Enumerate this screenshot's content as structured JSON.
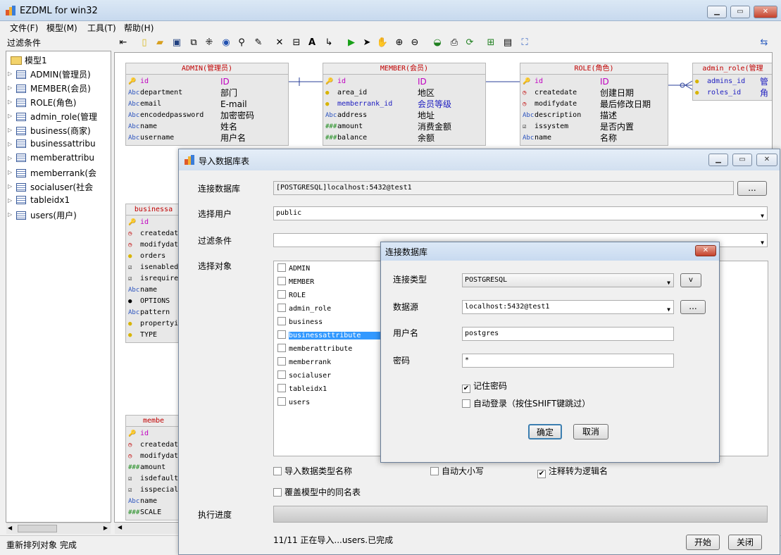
{
  "window": {
    "title": "EZDML for win32"
  },
  "menu": [
    "文件(F)",
    "模型(M)",
    "工具(T)",
    "帮助(H)"
  ],
  "left_panel": {
    "filter_label": "过滤条件",
    "root": "模型1",
    "items": [
      "ADMIN(管理员)",
      "MEMBER(会员)",
      "ROLE(角色)",
      "admin_role(管理",
      "business(商家)",
      "businessattribu",
      "memberattribu",
      "memberrank(会",
      "socialuser(社会",
      "tableidx1",
      "users(用户)"
    ]
  },
  "entities": {
    "admin": {
      "title": "ADMIN(管理员)",
      "fields": [
        {
          "icon": "key",
          "name": "id",
          "label": "ID",
          "kind": "pk"
        },
        {
          "icon": "abc",
          "name": "department",
          "label": "部门"
        },
        {
          "icon": "abc",
          "name": "email",
          "label": "E-mail"
        },
        {
          "icon": "abc",
          "name": "encodedpassword",
          "label": "加密密码"
        },
        {
          "icon": "abc",
          "name": "name",
          "label": "姓名"
        },
        {
          "icon": "abc",
          "name": "username",
          "label": "用户名"
        }
      ]
    },
    "member": {
      "title": "MEMBER(会员)",
      "fields": [
        {
          "icon": "key",
          "name": "id",
          "label": "ID",
          "kind": "pk"
        },
        {
          "icon": "bulb",
          "name": "area_id",
          "label": "地区"
        },
        {
          "icon": "bulb",
          "name": "memberrank_id",
          "label": "会员等级",
          "kind": "fk"
        },
        {
          "icon": "abc",
          "name": "address",
          "label": "地址"
        },
        {
          "icon": "num",
          "name": "amount",
          "label": "消费金额"
        },
        {
          "icon": "num",
          "name": "balance",
          "label": "余额"
        }
      ]
    },
    "role": {
      "title": "ROLE(角色)",
      "fields": [
        {
          "icon": "key",
          "name": "id",
          "label": "ID",
          "kind": "pk"
        },
        {
          "icon": "clock",
          "name": "createdate",
          "label": "创建日期"
        },
        {
          "icon": "clock",
          "name": "modifydate",
          "label": "最后修改日期"
        },
        {
          "icon": "abc",
          "name": "description",
          "label": "描述"
        },
        {
          "icon": "check",
          "name": "issystem",
          "label": "是否内置"
        },
        {
          "icon": "abc",
          "name": "name",
          "label": "名称"
        }
      ]
    },
    "admin_role": {
      "title": "admin_role(管理",
      "fields": [
        {
          "icon": "bulb",
          "name": "admins_id",
          "label": "管",
          "kind": "fk"
        },
        {
          "icon": "bulb",
          "name": "roles_id",
          "label": "角",
          "kind": "fk"
        }
      ]
    },
    "business": {
      "title": "businessa",
      "fields": [
        {
          "icon": "key",
          "name": "id",
          "kind": "pk"
        },
        {
          "icon": "clock",
          "name": "createdat"
        },
        {
          "icon": "clock",
          "name": "modifydat"
        },
        {
          "icon": "bulb",
          "name": "orders"
        },
        {
          "icon": "check",
          "name": "isenabled"
        },
        {
          "icon": "check",
          "name": "isrequire"
        },
        {
          "icon": "abc",
          "name": "name"
        },
        {
          "icon": "dot",
          "name": "OPTIONS"
        },
        {
          "icon": "abc",
          "name": "pattern"
        },
        {
          "icon": "bulb",
          "name": "propertyi"
        },
        {
          "icon": "bulb",
          "name": "TYPE"
        }
      ]
    },
    "memberattr": {
      "title": "membe",
      "fields": [
        {
          "icon": "key",
          "name": "id",
          "kind": "pk"
        },
        {
          "icon": "clock",
          "name": "createdat"
        },
        {
          "icon": "clock",
          "name": "modifydat"
        },
        {
          "icon": "num",
          "name": "amount"
        },
        {
          "icon": "check",
          "name": "isdefault"
        },
        {
          "icon": "check",
          "name": "isspecial"
        },
        {
          "icon": "abc",
          "name": "name"
        },
        {
          "icon": "num",
          "name": "SCALE"
        }
      ]
    }
  },
  "import_dialog": {
    "title": "导入数据库表",
    "connect_label": "连接数据库",
    "connect_value": "[POSTGRESQL]localhost:5432@test1",
    "browse_button": "...",
    "user_label": "选择用户",
    "user_value": "public",
    "filter_label": "过滤条件",
    "filter_value": "",
    "objects_label": "选择对象",
    "objects": [
      "ADMIN",
      "MEMBER",
      "ROLE",
      "admin_role",
      "business",
      "businessattribute",
      "memberattribute",
      "memberrank",
      "socialuser",
      "tableidx1",
      "users"
    ],
    "selected_object": "businessattribute",
    "opt_import_type": "导入数据类型名称",
    "opt_auto_case": "自动大小写",
    "opt_comment_logic": "注释转为逻辑名",
    "opt_overwrite": "覆盖模型中的同名表",
    "progress_label": "执行进度",
    "progress": 1.0,
    "status": "11/11 正在导入...users.已完成",
    "start_button": "开始",
    "close_button": "关闭"
  },
  "connect_dialog": {
    "title": "连接数据库",
    "type_label": "连接类型",
    "type_value": "POSTGRESQL",
    "v_button": "v",
    "source_label": "数据源",
    "source_value": "localhost:5432@test1",
    "source_button": "...",
    "user_label": "用户名",
    "user_value": "postgres",
    "password_label": "密码",
    "password_value": "*",
    "remember": "记住密码",
    "remember_checked": true,
    "autologin": "自动登录（按住SHIFT键跳过）",
    "autologin_checked": false,
    "ok": "确定",
    "cancel": "取消"
  },
  "statusbar": {
    "text": "重新排列对象 完成"
  }
}
